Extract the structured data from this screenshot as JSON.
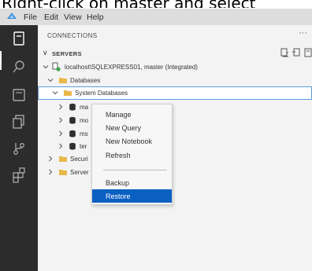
{
  "caption": "Right-click on master and select",
  "menu": [
    "File",
    "Edit",
    "View",
    "Help"
  ],
  "sidebar": {
    "title": "CONNECTIONS",
    "more": "···",
    "section": "SERVERS"
  },
  "tree": [
    {
      "label": "localhost\\SQLEXPRESS01, master (Integrated)"
    },
    {
      "label": "Databases"
    },
    {
      "label": "System Databases"
    },
    {
      "label": "ma"
    },
    {
      "label": "mo"
    },
    {
      "label": "ms"
    },
    {
      "label": "ter"
    },
    {
      "label": "Securi"
    },
    {
      "label": "Server"
    }
  ],
  "context_menu": {
    "items": [
      "Manage",
      "New Query",
      "New Notebook",
      "Refresh",
      "Backup",
      "Restore"
    ],
    "highlighted": "Restore"
  },
  "colors": {
    "activity_bar": "#2c2c2c",
    "sidebar_bg": "#f3f3f3",
    "menubar_bg": "#dddddd",
    "highlight": "#0a60c2",
    "folder": "#e8b84a",
    "server_green": "#3aa64a"
  }
}
